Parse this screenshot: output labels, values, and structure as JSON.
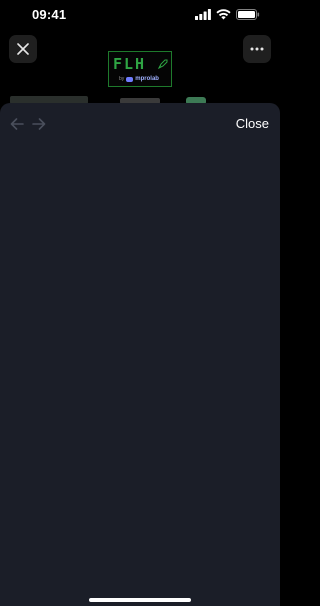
{
  "status_bar": {
    "time": "09:41"
  },
  "background_app": {
    "logo_text": "FLH",
    "logo_by": "by",
    "logo_brand": "mprolab"
  },
  "sheet": {
    "close_label": "Close",
    "back_enabled": false,
    "forward_enabled": false
  },
  "icons": {
    "close": "close-icon",
    "more": "more-horizontal-icon",
    "back": "arrow-left-icon",
    "forward": "arrow-right-icon"
  },
  "colors": {
    "sheet_bg": "#1b1e28",
    "logo_green": "#2fa544",
    "nav_disabled": "#4a4f5c"
  }
}
